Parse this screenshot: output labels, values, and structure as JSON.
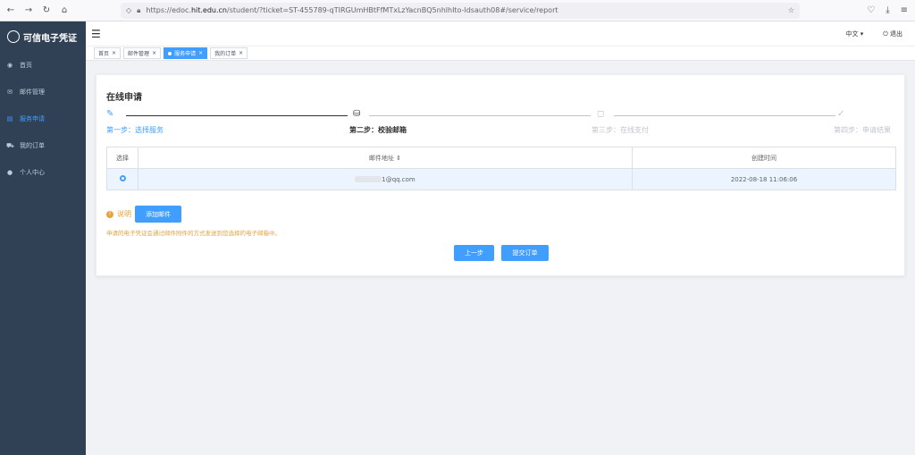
{
  "browser": {
    "url_prefix": "https://edoc.",
    "url_domain": "hit.edu.cn",
    "url_suffix": "/student/?ticket=ST-455789-qTIRGUmHBtFfMTxLzYacnBQ5nhlhIto-ldsauth08#/service/report"
  },
  "sidebar": {
    "logo_text": "可信电子凭证",
    "items": [
      {
        "label": "首页",
        "icon": "dashboard-icon"
      },
      {
        "label": "邮件管理",
        "icon": "mail-icon"
      },
      {
        "label": "服务申请",
        "icon": "document-icon"
      },
      {
        "label": "我的订单",
        "icon": "cart-icon"
      },
      {
        "label": "个人中心",
        "icon": "user-icon"
      }
    ]
  },
  "header": {
    "language": "中文",
    "logout": "退出"
  },
  "tags": [
    {
      "label": "首页"
    },
    {
      "label": "邮件管理"
    },
    {
      "label": "服务申请"
    },
    {
      "label": "我的订单"
    }
  ],
  "main": {
    "title": "在线申请",
    "steps": [
      {
        "label": "第一步：选择服务",
        "icon": "edit-icon",
        "state": "done"
      },
      {
        "label": "第二步：校验邮箱",
        "icon": "inbox-icon",
        "state": "active"
      },
      {
        "label": "第三步：在线支付",
        "icon": "bag-icon",
        "state": "pending"
      },
      {
        "label": "第四步：申请结果",
        "icon": "check-circle-icon",
        "state": "pending"
      }
    ],
    "table": {
      "headers": [
        "选择",
        "邮件地址 ⇕",
        "创建时间"
      ],
      "rows": [
        {
          "email": "1@qq.com",
          "created": "2022-08-18 11:06:06",
          "selected": true
        }
      ]
    },
    "note_label": "说明",
    "add_email_button": "添加邮件",
    "hint": "申请的电子凭证会通过邮件附件的方式发送到您选择的电子邮箱中。",
    "prev_button": "上一步",
    "submit_button": "提交订单"
  },
  "colors": {
    "sidebar_bg": "#304156",
    "accent": "#409eff",
    "warning": "#e6a23c"
  }
}
